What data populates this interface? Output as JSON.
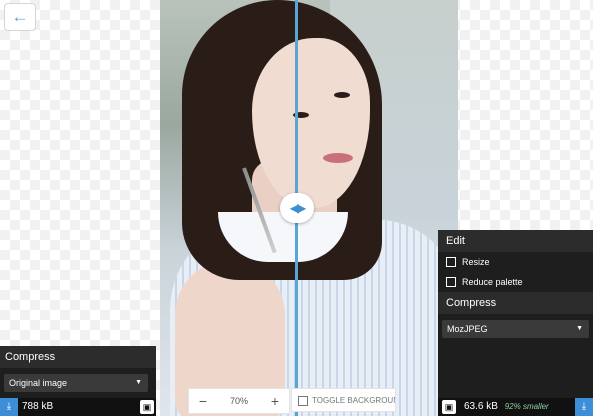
{
  "back_button": {
    "icon": "arrow-left-icon"
  },
  "left_panel": {
    "title": "Compress",
    "method": "Original image",
    "size": "788 kB"
  },
  "right_panel": {
    "edit_title": "Edit",
    "options": [
      {
        "label": "Resize",
        "checked": false
      },
      {
        "label": "Reduce palette",
        "checked": false
      }
    ],
    "compress_title": "Compress",
    "method": "MozJPEG",
    "size": "63.6 kB",
    "savings": "92% smaller"
  },
  "zoom": {
    "minus": "−",
    "value": "70",
    "unit": "%",
    "plus": "+"
  },
  "toggle_background_label": "TOGGLE BACKGROUND",
  "colors": {
    "accent": "#3c8fd6",
    "divider": "#5aa5d6",
    "panel": "#1e1e1e",
    "savings": "#8ad0a0"
  }
}
